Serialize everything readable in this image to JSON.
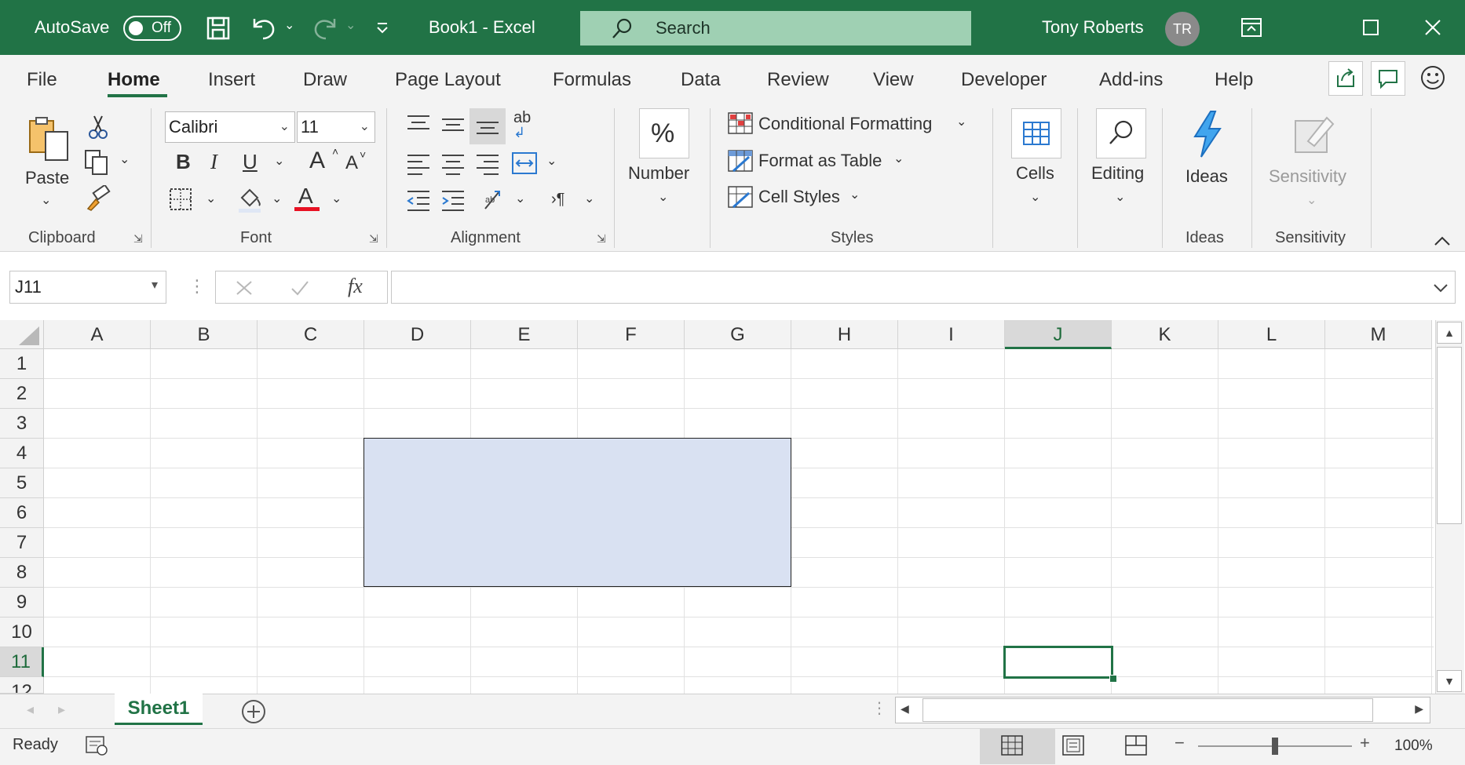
{
  "titlebar": {
    "autosave_label": "AutoSave",
    "autosave_state": "Off",
    "document_title": "Book1  -  Excel",
    "search_placeholder": "Search",
    "user_name": "Tony Roberts",
    "user_initials": "TR"
  },
  "ribbon_tabs": [
    "File",
    "Home",
    "Insert",
    "Draw",
    "Page Layout",
    "Formulas",
    "Data",
    "Review",
    "View",
    "Developer",
    "Add-ins",
    "Help"
  ],
  "active_tab": "Home",
  "clipboard": {
    "paste_label": "Paste",
    "group_label": "Clipboard"
  },
  "font": {
    "family": "Calibri",
    "size": "11",
    "bold": "B",
    "italic": "I",
    "underline": "U",
    "grow": "A",
    "shrink": "A",
    "font_color": "A",
    "group_label": "Font"
  },
  "alignment": {
    "wrap_glyph": "ab",
    "group_label": "Alignment"
  },
  "number": {
    "label": "Number",
    "percent": "%"
  },
  "styles": {
    "conditional": "Conditional Formatting",
    "format_table": "Format as Table",
    "cell_styles": "Cell Styles",
    "group_label": "Styles"
  },
  "cells": {
    "label": "Cells"
  },
  "editing": {
    "label": "Editing"
  },
  "ideas": {
    "label": "Ideas",
    "group_label": "Ideas"
  },
  "sensitivity": {
    "label": "Sensitivity",
    "group_label": "Sensitivity"
  },
  "formula_bar": {
    "name_box": "J11",
    "fx": "fx",
    "formula_value": ""
  },
  "grid": {
    "columns": [
      "A",
      "B",
      "C",
      "D",
      "E",
      "F",
      "G",
      "H",
      "I",
      "J",
      "K",
      "L",
      "M"
    ],
    "rows": [
      "1",
      "2",
      "3",
      "4",
      "5",
      "6",
      "7",
      "8",
      "9",
      "10",
      "11",
      "12"
    ],
    "active_cell": "J11",
    "active_column": "J",
    "active_row": "11"
  },
  "sheets": {
    "tabs": [
      "Sheet1"
    ],
    "active": "Sheet1"
  },
  "status": {
    "ready": "Ready",
    "zoom": "100%"
  },
  "colors": {
    "brand": "#217346",
    "shape_fill": "#d9e1f2",
    "search_bg": "#9fd0b3"
  }
}
